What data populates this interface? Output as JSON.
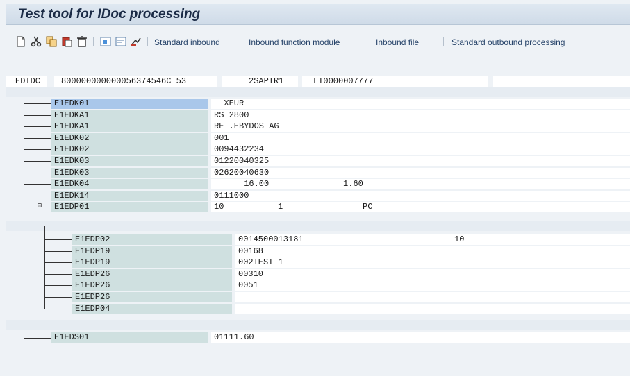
{
  "window": {
    "title": "Test tool for IDoc processing"
  },
  "toolbar": {
    "icons": [
      "new-document-icon",
      "cut-icon",
      "copy-icon",
      "paste-icon",
      "delete-icon",
      "insert-icon",
      "edit-icon",
      "sign-icon"
    ],
    "buttons": {
      "standard_inbound": "Standard inbound",
      "inbound_fm": "Inbound function module",
      "inbound_file": "Inbound file",
      "standard_outbound": "Standard outbound processing"
    }
  },
  "control": {
    "label": "EDIDC",
    "f1": "800000000000056374546C 53",
    "f2": "2SAPTR1",
    "f3": "LI0000007777",
    "f4": ""
  },
  "segments": [
    {
      "name": "E1EDK01",
      "v1": "  XEUR",
      "v2": "",
      "v3": ""
    },
    {
      "name": "E1EDKA1",
      "v1": "RS 2800",
      "v2": "",
      "v3": ""
    },
    {
      "name": "E1EDKA1",
      "v1": "RE .EBYDOS AG",
      "v2": "",
      "v3": ""
    },
    {
      "name": "E1EDK02",
      "v1": "001",
      "v2": "",
      "v3": ""
    },
    {
      "name": "E1EDK02",
      "v1": "0094432234",
      "v2": "",
      "v3": ""
    },
    {
      "name": "E1EDK03",
      "v1": "01220040325",
      "v2": "",
      "v3": ""
    },
    {
      "name": "E1EDK03",
      "v1": "02620040630",
      "v2": "",
      "v3": ""
    },
    {
      "name": "E1EDK04",
      "v1": "      16.00",
      "v2": "1.60",
      "v3": ""
    },
    {
      "name": "E1EDK14",
      "v1": "0111000",
      "v2": "",
      "v3": ""
    },
    {
      "name": "E1EDP01",
      "v1": "10",
      "v2": "1",
      "v3": "PC"
    }
  ],
  "subsegments": [
    {
      "name": "E1EDP02",
      "v1": "0014500013181",
      "v2": "10"
    },
    {
      "name": "E1EDP19",
      "v1": "00168",
      "v2": ""
    },
    {
      "name": "E1EDP19",
      "v1": "002TEST 1",
      "v2": ""
    },
    {
      "name": "E1EDP26",
      "v1": "00310",
      "v2": ""
    },
    {
      "name": "E1EDP26",
      "v1": "0051",
      "v2": ""
    },
    {
      "name": "E1EDP26",
      "v1": "",
      "v2": ""
    },
    {
      "name": "E1EDP04",
      "v1": "",
      "v2": ""
    }
  ],
  "trailer": {
    "name": "E1EDS01",
    "v1": "01111.60"
  },
  "colors": {
    "selected": "#a9c7ea",
    "segment": "#cfe0e0",
    "toolbar_text": "#27446a"
  }
}
